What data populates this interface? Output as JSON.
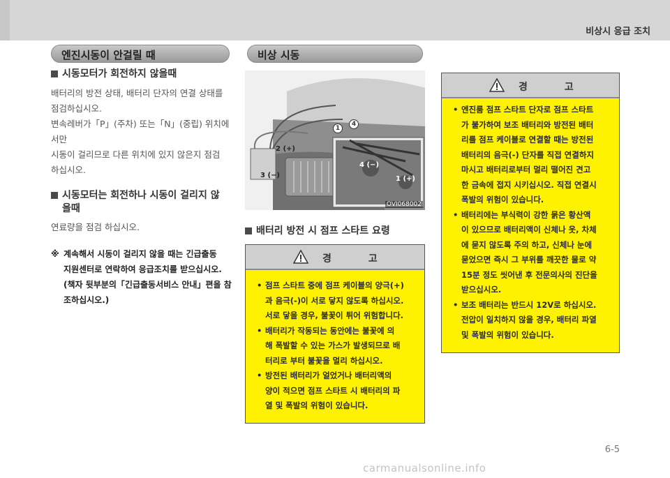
{
  "header": {
    "section_title": "비상시 응급 조치"
  },
  "left": {
    "pill": "엔진시동이 안걸릴 때",
    "h1": "시동모터가 회전하지 않을때",
    "p1": [
      "배터리의 방전 상태, 배터리 단자의 연결 상태를",
      "점검하십시오.",
      "변속레버가「P」(주차) 또는「N」(중립) 위치에서만",
      "시동이 걸리므로 다른 위치에 있지 않은지 점검",
      "하십시오."
    ],
    "h2": [
      "시동모터는 회전하나 시동이 걸리지 않",
      "을때"
    ],
    "p2": "연료량을 점검 하십시오.",
    "note_mark": "※",
    "note": [
      "계속해서 시동이 걸리지 않을 때는 긴급출동",
      "지원센터로 연락하여 응급조치를 받으십시오.",
      "(책자 뒷부분의「긴급출동서비스 안내」편을 참",
      "조하십시오.)"
    ]
  },
  "middle": {
    "pill": "비상 시동",
    "photo_code": "OVI068002",
    "callouts": [
      "1",
      "4",
      "2 (+)",
      "3 (−)",
      "4 (−)",
      "1 (+)"
    ],
    "h": "배터리 방전 시 점프 스타트 요령",
    "warn_title": "경 고",
    "warn_items": [
      [
        "점프 스타트 중에 점프 케이블의 양극(+)",
        "과 음극(-)이 서로 닿지 않도록 하십시오.",
        "서로 닿을 경우, 불꽃이 튀어 위험합니다."
      ],
      [
        "배터리가 작동되는 동안에는 불꽃에 의",
        "해 폭발할 수 있는 가스가 발생되므로 배",
        "터리로 부터 불꽃을 멀리 하십시오."
      ],
      [
        "방전된 배터리가 얼었거나 배터리액의",
        "양이 적으면 점프 스타트 시 배터리의 파",
        "열 및 폭발의 위험이 있습니다."
      ]
    ]
  },
  "right": {
    "warn_title": "경 고",
    "warn_items": [
      [
        "엔진룸 점프 스타트 단자로 점프 스타트",
        "가 불가하여 보조 배터리와 방전된 배터",
        "리를 점프 케이블로 연결할 때는 방전된",
        "배터리의 음극(-) 단자를 직접 연결하지",
        "마시고 배터리로부터 멀리 떨어진 견고",
        "한 금속에 접지 시키십시오. 직접 연결시",
        "폭발의 위험이 있습니다."
      ],
      [
        "배터리에는 부식력이 강한 묽은 황산액",
        "이 있으므로 배터리액이 신체나 옷, 차체",
        "에 묻지 않도록 주의 하고, 신체나 눈에",
        "묻었으면 즉시 그 부위를 깨끗한 물로 약",
        "15분 정도 씻어낸 후 전문의사의 진단을",
        "받으십시오."
      ],
      [
        "보조 배터리는 반드시 12V로 하십시오.",
        "전압이 일치하지 않을 경우, 배터리 파열",
        "및 폭발의 위험이 있습니다."
      ]
    ]
  },
  "footer": {
    "page_number": "6-5",
    "watermark": "carmanualsonline.info"
  }
}
